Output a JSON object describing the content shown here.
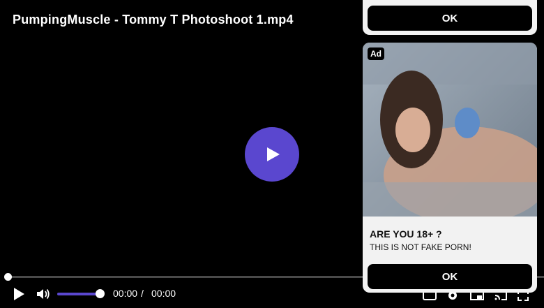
{
  "video": {
    "title": "PumpingMuscle - Tommy T Photoshoot 1.mp4",
    "current_time": "00:00",
    "separator": "/",
    "duration": "00:00",
    "progress": 0,
    "volume": 1.0
  },
  "icons": {
    "big_play": "play-icon",
    "play": "play-icon",
    "volume": "volume-icon",
    "right": [
      "subtitles-icon",
      "settings-icon",
      "pip-icon",
      "cast-icon",
      "fullscreen-icon"
    ]
  },
  "ad_top": {
    "ok_label": "OK"
  },
  "ad": {
    "badge": "Ad",
    "headline": "ARE YOU 18+ ?",
    "body": "THIS IS NOT FAKE PORN!",
    "ok_label": "OK"
  },
  "colors": {
    "accent": "#5a47cf",
    "panel": "#f2f2f2",
    "background": "#000000"
  }
}
